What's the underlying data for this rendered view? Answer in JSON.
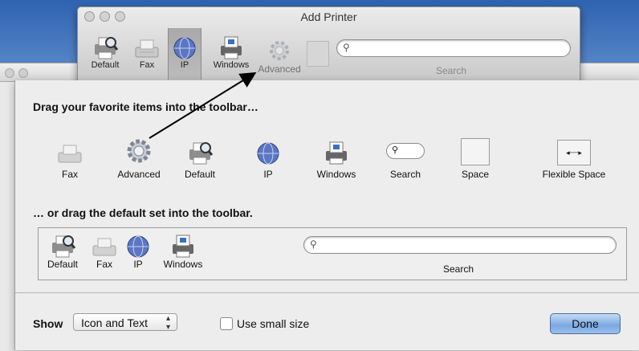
{
  "front_window": {
    "title": "Add Printer",
    "toolbar": [
      {
        "label": "Default",
        "icon": "printer-search-icon"
      },
      {
        "label": "Fax",
        "icon": "fax-icon"
      },
      {
        "label": "IP",
        "icon": "globe-icon"
      },
      {
        "label": "Windows",
        "icon": "windows-printer-icon"
      }
    ],
    "dragging_label": "Advanced",
    "search_label": "Search"
  },
  "sheet": {
    "heading1": "Drag your favorite items into the toolbar…",
    "palette": [
      {
        "label": "Fax",
        "icon": "fax-icon"
      },
      {
        "label": "Advanced",
        "icon": "gear-icon"
      },
      {
        "label": "Default",
        "icon": "printer-search-icon"
      },
      {
        "label": "IP",
        "icon": "globe-icon"
      },
      {
        "label": "Windows",
        "icon": "windows-printer-icon"
      },
      {
        "label": "Search",
        "icon": "search-field-icon"
      },
      {
        "label": "Space",
        "icon": "space-icon"
      },
      {
        "label": "Flexible Space",
        "icon": "flexible-space-icon"
      }
    ],
    "heading2": "… or drag the default set into the toolbar.",
    "default_set": [
      {
        "label": "Default"
      },
      {
        "label": "Fax"
      },
      {
        "label": "IP"
      },
      {
        "label": "Windows"
      }
    ],
    "default_search_label": "Search",
    "show_label": "Show",
    "show_value": "Icon and Text",
    "small_size_label": "Use small size",
    "small_size_checked": false,
    "done_label": "Done"
  },
  "colors": {
    "accent": "#7aa8e1",
    "desktop": "#3b6aa8"
  }
}
